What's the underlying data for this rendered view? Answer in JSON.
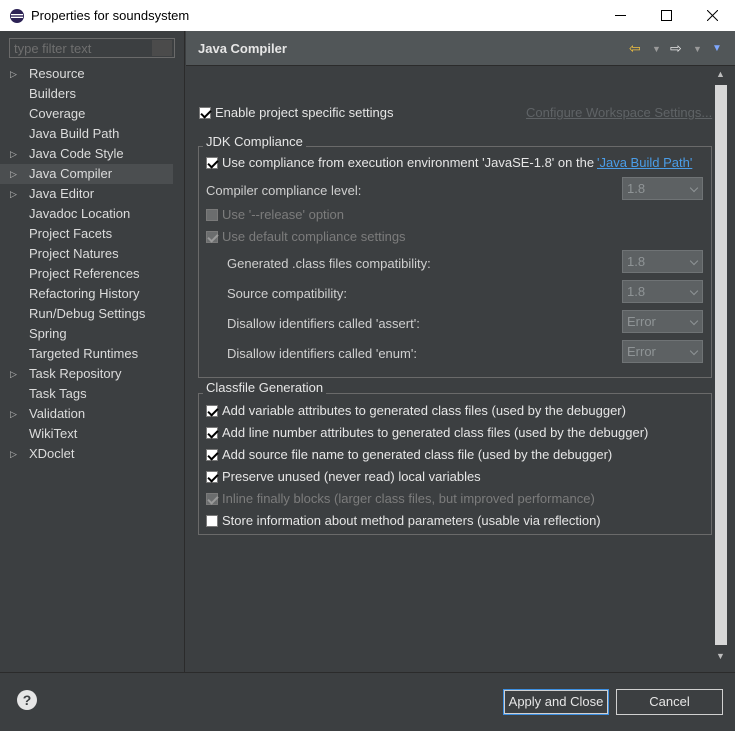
{
  "window": {
    "title": "Properties for soundsystem"
  },
  "filter": {
    "placeholder": "type filter text"
  },
  "tree": [
    {
      "label": "Resource",
      "expandable": true
    },
    {
      "label": "Builders",
      "expandable": false
    },
    {
      "label": "Coverage",
      "expandable": false
    },
    {
      "label": "Java Build Path",
      "expandable": false
    },
    {
      "label": "Java Code Style",
      "expandable": true
    },
    {
      "label": "Java Compiler",
      "expandable": true,
      "selected": true
    },
    {
      "label": "Java Editor",
      "expandable": true
    },
    {
      "label": "Javadoc Location",
      "expandable": false
    },
    {
      "label": "Project Facets",
      "expandable": false
    },
    {
      "label": "Project Natures",
      "expandable": false
    },
    {
      "label": "Project References",
      "expandable": false
    },
    {
      "label": "Refactoring History",
      "expandable": false
    },
    {
      "label": "Run/Debug Settings",
      "expandable": false
    },
    {
      "label": "Spring",
      "expandable": false
    },
    {
      "label": "Targeted Runtimes",
      "expandable": false
    },
    {
      "label": "Task Repository",
      "expandable": true
    },
    {
      "label": "Task Tags",
      "expandable": false
    },
    {
      "label": "Validation",
      "expandable": true
    },
    {
      "label": "WikiText",
      "expandable": false
    },
    {
      "label": "XDoclet",
      "expandable": true
    }
  ],
  "page": {
    "title": "Java Compiler",
    "enable_specific": "Enable project specific settings",
    "configure_workspace": "Configure Workspace Settings...",
    "jdk": {
      "title": "JDK Compliance",
      "use_compliance_prefix": "Use compliance from execution environment 'JavaSE-1.8' on the ",
      "use_compliance_link": "'Java Build Path'",
      "compliance_level_label": "Compiler compliance level:",
      "compliance_level_value": "1.8",
      "use_release": "Use '--release' option",
      "use_default": "Use default compliance settings",
      "generated_label": "Generated .class files compatibility:",
      "generated_value": "1.8",
      "source_label": "Source compatibility:",
      "source_value": "1.8",
      "assert_label": "Disallow identifiers called 'assert':",
      "assert_value": "Error",
      "enum_label": "Disallow identifiers called 'enum':",
      "enum_value": "Error"
    },
    "classfile": {
      "title": "Classfile Generation",
      "items": [
        {
          "label": "Add variable attributes to generated class files (used by the debugger)",
          "checked": true,
          "enabled": true
        },
        {
          "label": "Add line number attributes to generated class files (used by the debugger)",
          "checked": true,
          "enabled": true
        },
        {
          "label": "Add source file name to generated class file (used by the debugger)",
          "checked": true,
          "enabled": true
        },
        {
          "label": "Preserve unused (never read) local variables",
          "checked": true,
          "enabled": true
        },
        {
          "label": "Inline finally blocks (larger class files, but improved performance)",
          "checked": true,
          "enabled": false
        },
        {
          "label": "Store information about method parameters (usable via reflection)",
          "checked": false,
          "enabled": true
        }
      ]
    }
  },
  "buttons": {
    "apply_close": "Apply and Close",
    "cancel": "Cancel",
    "help": "?"
  },
  "icons": {
    "minimize": "minimize-icon",
    "maximize": "maximize-icon",
    "close": "close-icon",
    "back": "back-arrow-icon",
    "forward": "forward-arrow-icon",
    "menu": "view-menu-icon",
    "help": "help-icon"
  },
  "colors": {
    "background": "#3c3f41",
    "header": "#515658",
    "link": "#4a9de8",
    "accent_border": "#3c8ee0"
  }
}
